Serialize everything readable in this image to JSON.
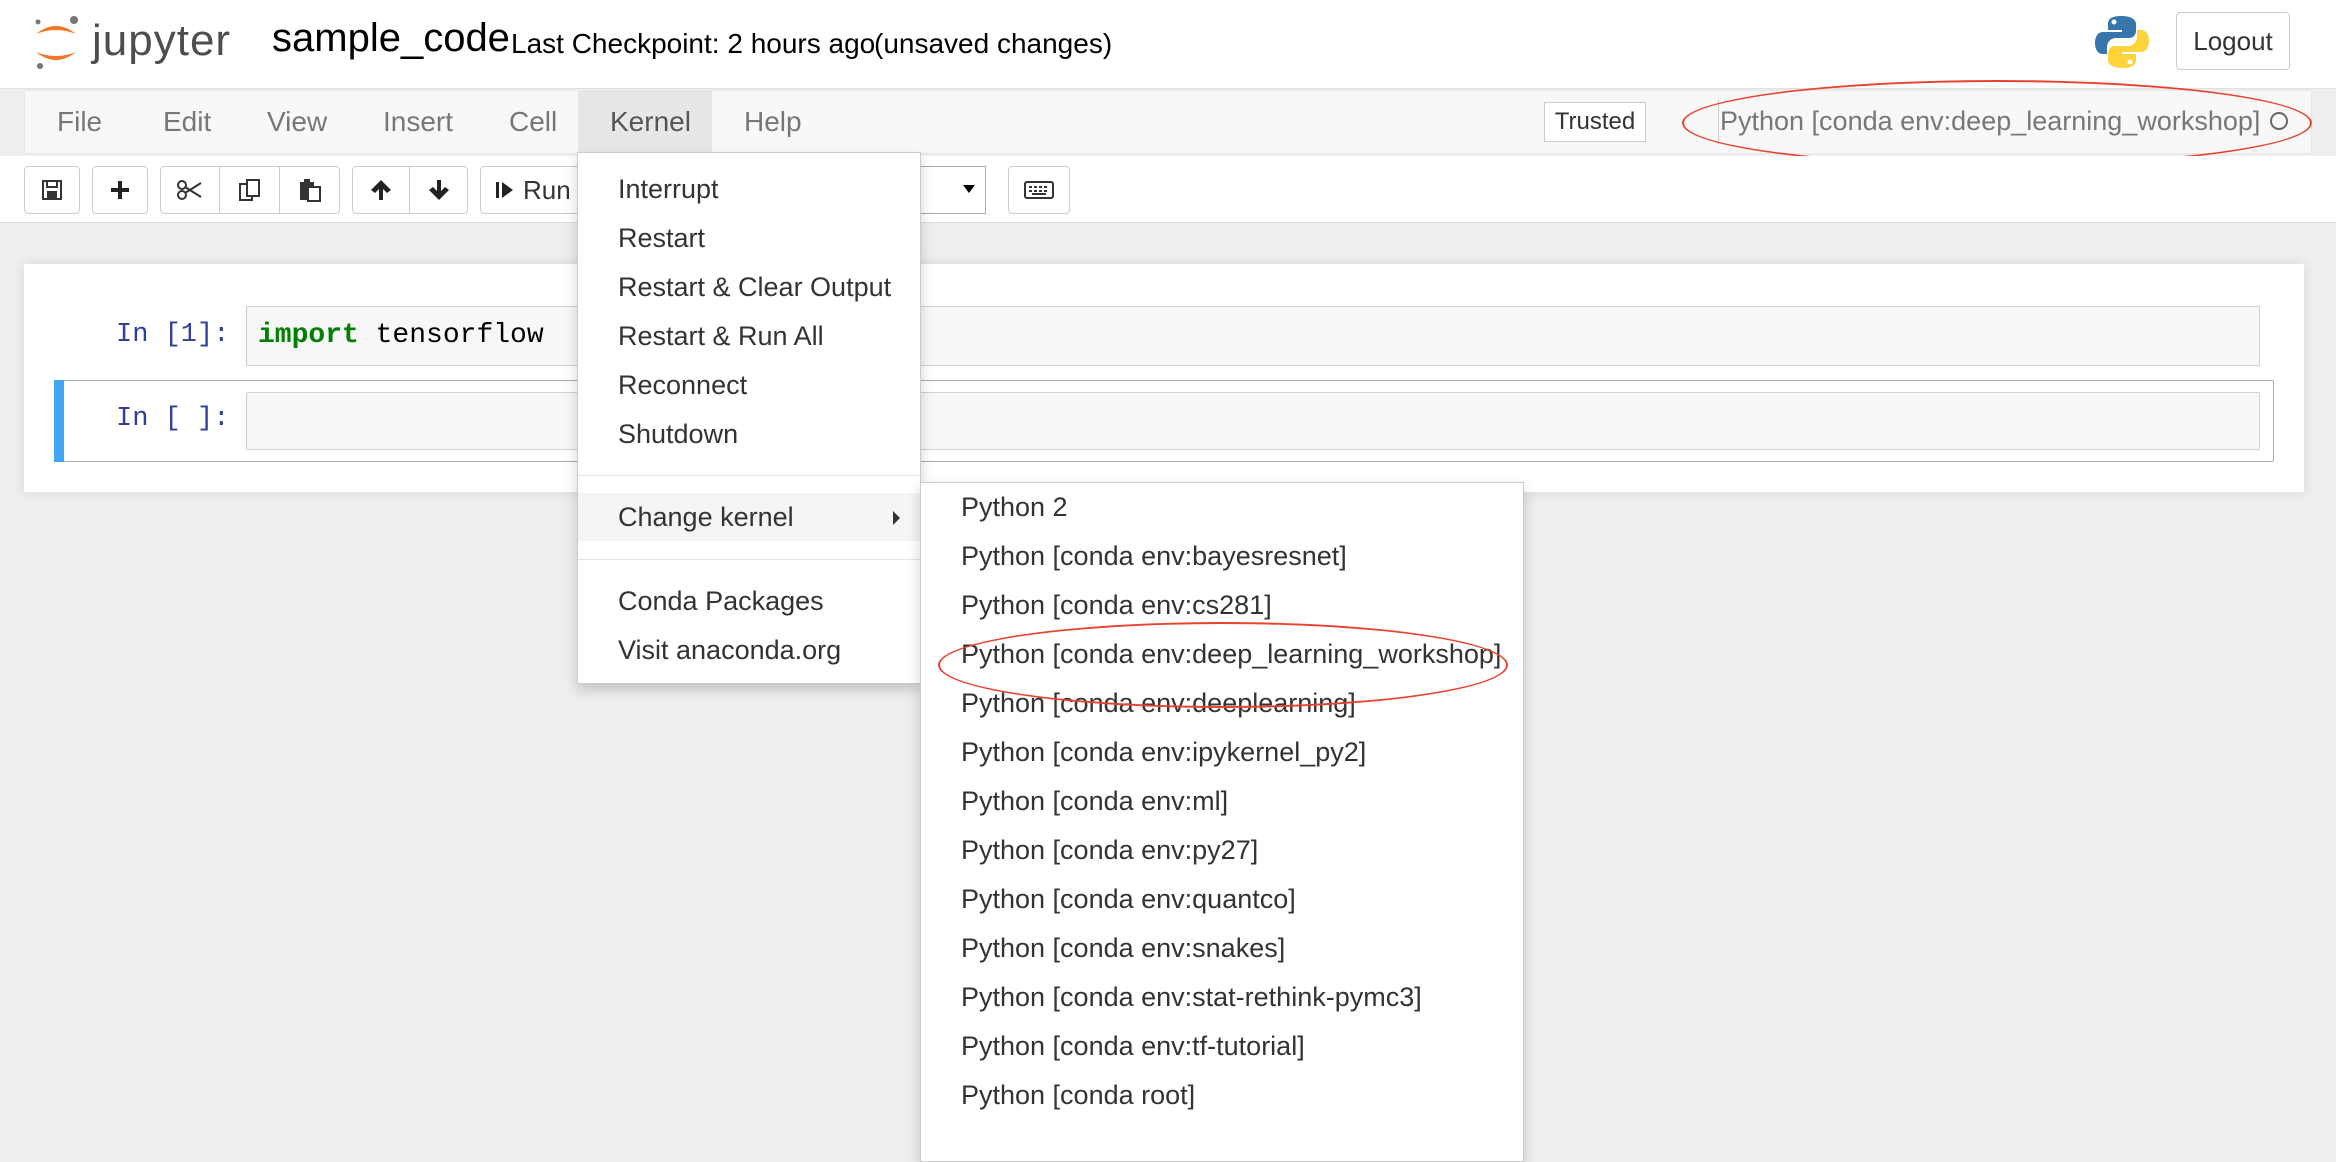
{
  "header": {
    "logo_text": "jupyter",
    "notebook_name": "sample_code",
    "checkpoint": "Last Checkpoint: 2 hours ago",
    "unsaved": "(unsaved changes)",
    "logout_label": "Logout",
    "python_logo_icon": "python-logo-icon"
  },
  "menubar": {
    "items": [
      "File",
      "Edit",
      "View",
      "Insert",
      "Cell",
      "Kernel",
      "Help"
    ],
    "active": "Kernel",
    "trusted_label": "Trusted",
    "kernel_name": "Python [conda env:deep_learning_workshop]",
    "kernel_status_icon": "kernel-idle-circle-icon"
  },
  "toolbar": {
    "run_label": "Run",
    "icons": [
      "save-icon",
      "plus-icon",
      "cut-icon",
      "copy-icon",
      "paste-icon",
      "arrow-up-icon",
      "arrow-down-icon",
      "step-forward-icon",
      "keyboard-icon"
    ]
  },
  "cells": [
    {
      "prompt": "In [1]:",
      "code_keyword": "import",
      "code_rest": " tensorflow"
    },
    {
      "prompt": "In [ ]:",
      "code_keyword": "",
      "code_rest": ""
    }
  ],
  "kernel_menu": {
    "items": [
      "Interrupt",
      "Restart",
      "Restart & Clear Output",
      "Restart & Run All",
      "Reconnect",
      "Shutdown"
    ],
    "change_kernel": "Change kernel",
    "extra_items": [
      "Conda Packages",
      "Visit anaconda.org"
    ]
  },
  "change_kernel_submenu": {
    "items": [
      "Python 2",
      "Python [conda env:bayesresnet]",
      "Python [conda env:cs281]",
      "Python [conda env:deep_learning_workshop]",
      "Python [conda env:deeplearning]",
      "Python [conda env:ipykernel_py2]",
      "Python [conda env:ml]",
      "Python [conda env:py27]",
      "Python [conda env:quantco]",
      "Python [conda env:snakes]",
      "Python [conda env:stat-rethink-pymc3]",
      "Python [conda env:tf-tutorial]",
      "Python [conda root]"
    ],
    "highlighted": "Python [conda env:deep_learning_workshop]"
  },
  "colors": {
    "annotation_red": "#e8432f",
    "jupyter_orange": "#f37626",
    "selected_cell_blue": "#42a5f5",
    "prompt_blue": "#303f9f",
    "keyword_green": "#008000"
  }
}
